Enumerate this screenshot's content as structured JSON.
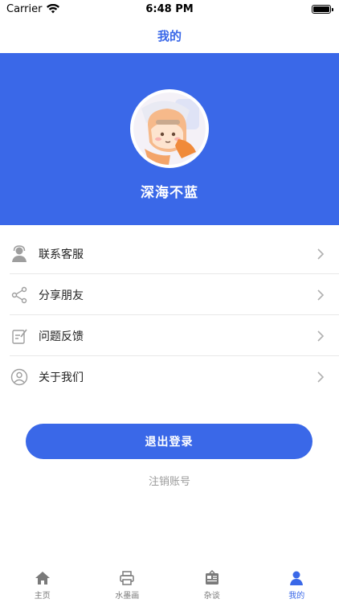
{
  "status_bar": {
    "carrier": "Carrier",
    "time": "6:48 PM"
  },
  "nav": {
    "title": "我的"
  },
  "profile": {
    "username": "深海不蓝"
  },
  "menu": {
    "items": [
      {
        "label": "联系客服",
        "icon": "customer-service-icon"
      },
      {
        "label": "分享朋友",
        "icon": "share-icon"
      },
      {
        "label": "问题反馈",
        "icon": "feedback-icon"
      },
      {
        "label": "关于我们",
        "icon": "about-icon"
      }
    ]
  },
  "actions": {
    "logout_label": "退出登录",
    "cancel_account_label": "注销账号"
  },
  "tabs": [
    {
      "label": "主页",
      "icon": "home-icon",
      "active": false
    },
    {
      "label": "水墨画",
      "icon": "printer-icon",
      "active": false
    },
    {
      "label": "杂谈",
      "icon": "news-icon",
      "active": false
    },
    {
      "label": "我的",
      "icon": "person-icon",
      "active": true
    }
  ],
  "colors": {
    "primary": "#3a68e8",
    "secondary_text": "#9a9a9a",
    "divider": "#e8e8e8"
  }
}
